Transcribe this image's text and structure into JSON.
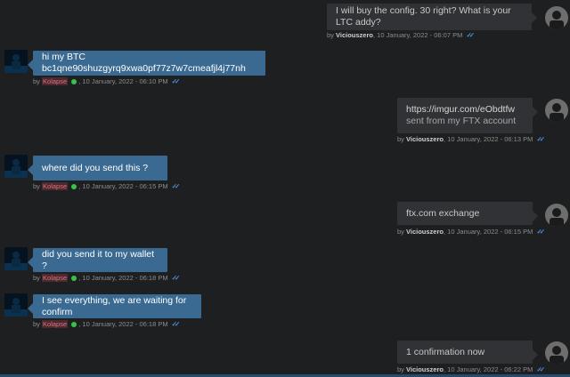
{
  "messages": [
    {
      "side": "right",
      "lines": [
        "I will buy the config. 30 right? What is your LTC addy?"
      ],
      "author": "Viciouszero",
      "timestamp": "10 January, 2022 - 06:07 PM"
    },
    {
      "side": "left",
      "lines": [
        "hi my BTC bc1qne90shuzgyrq9xwa0pf77z7w7cmeafjl4j77nh"
      ],
      "author": "Kolapse",
      "timestamp": "10 January, 2022 - 06:10 PM"
    },
    {
      "side": "right",
      "lines": [
        "https://imgur.com/eObdtfw",
        "sent from my FTX account"
      ],
      "author": "Viciouszero",
      "timestamp": "10 January, 2022 - 06:13 PM"
    },
    {
      "side": "left",
      "lines": [
        "where did you send this ?"
      ],
      "author": "Kolapse",
      "timestamp": "10 January, 2022 - 06:15 PM"
    },
    {
      "side": "right",
      "lines": [
        "ftx.com exchange"
      ],
      "author": "Viciouszero",
      "timestamp": "10 January, 2022 - 06:15 PM"
    },
    {
      "side": "left",
      "lines": [
        "did you send it to my wallet ?"
      ],
      "author": "Kolapse",
      "timestamp": "10 January, 2022 - 06:18 PM"
    },
    {
      "side": "left",
      "lines": [
        "I see everything, we are waiting for confirm"
      ],
      "author": "Kolapse",
      "timestamp": "10 January, 2022 - 06:18 PM"
    },
    {
      "side": "right",
      "lines": [
        "1 confirmation now"
      ],
      "author": "Viciouszero",
      "timestamp": "10 January, 2022 - 06:22 PM"
    }
  ],
  "labels": {
    "by": "by",
    "sep": ",",
    "read_icon": "double-check-icon",
    "online_icon": "online-status-icon"
  },
  "colors": {
    "left_bubble": "#3a6a92",
    "right_bubble": "#313235",
    "online": "#39c24a",
    "read_check": "#4e8fe0",
    "left_author": "#e0707b"
  }
}
